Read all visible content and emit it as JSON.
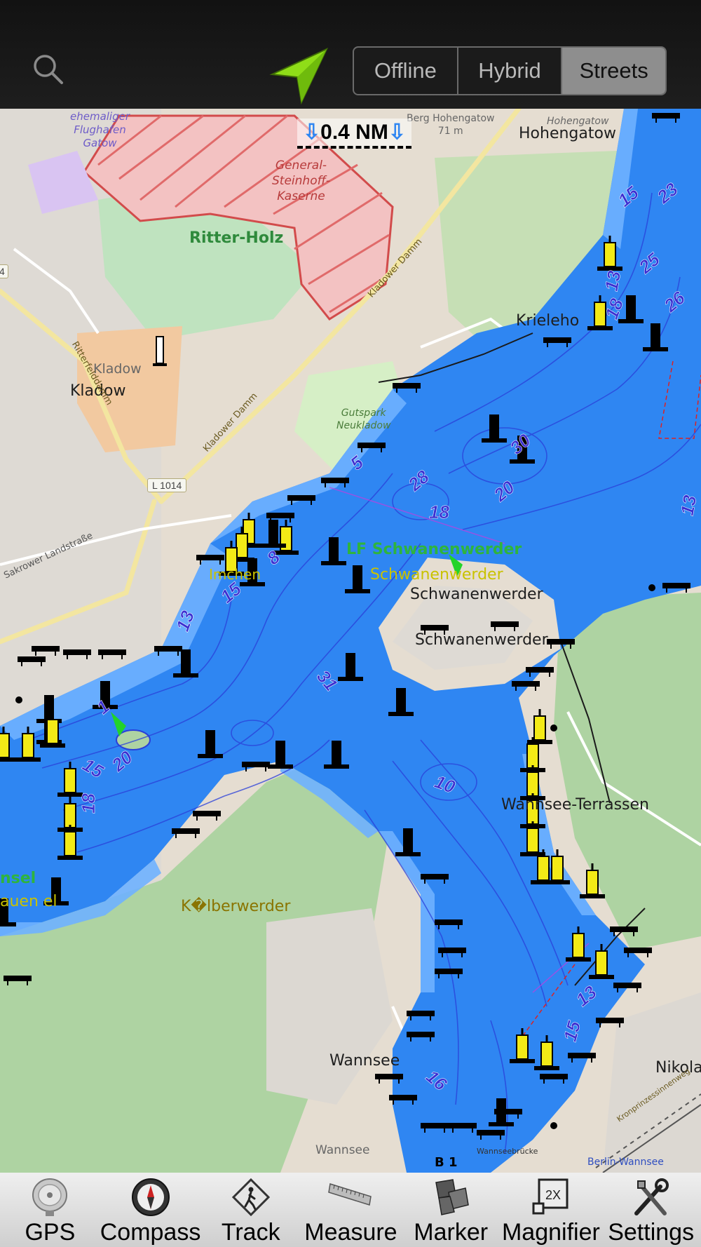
{
  "map_modes": {
    "offline": "Offline",
    "hybrid": "Hybrid",
    "streets": "Streets",
    "active": "Streets"
  },
  "scale_bar": "0.4 NM",
  "labels": {
    "airport": "ehemaliger\nFlughafen\nGatow",
    "kaserne": "General-\nSteinhoff-\nKaserne",
    "ritter_holz": "Ritter-Holz",
    "berg": "Berg Hohengatow\n71 m",
    "hohengatow_small": "Hohengatow",
    "hohengatow": "Hohengatow",
    "kladow_small": "Kladow",
    "kladow": "Kladow",
    "kladower_damm_1": "Kladower Damm",
    "kladower_damm_2": "Kladower Damm",
    "ritterfeld": "Ritterfelddamm",
    "gutspark": "Gutspark\nNeukladow",
    "l1014": "L 1014",
    "sakrower": "Sakrower Landstraße",
    "krieleho": "Krieleho",
    "lf_schwanenwerder": "LF Schwanenwerder",
    "schwanenwerder_yellow": "Schwanenwerder",
    "schwanenwerder_1": "Schwanenwerder",
    "schwanenwerder_2": "Schwanenwerder",
    "imchen": "Imchen",
    "wannsee_terrassen": "Wannsee-Terrassen",
    "pfaueninsel_1": "nsel",
    "pfaueninsel_2": "auen  el",
    "kaelberwerder": "K�lberwerder",
    "wannsee_1": "Wannsee",
    "wannsee_2": "Wannsee",
    "nikola": "Nikola",
    "b1": "B 1",
    "berlin_wannsee": "Berlin-Wannsee",
    "kronprinzessinnenweg": "Kronprinzessinnenweg",
    "wannseebruecke": "Wannseebrücke",
    "l4": "4"
  },
  "depths": [
    "15",
    "23",
    "13",
    "25",
    "18",
    "26",
    "5",
    "28",
    "30",
    "20",
    "18",
    "13",
    "15",
    "8",
    "13",
    "31",
    "1",
    "15",
    "20",
    "18",
    "10",
    "13",
    "15",
    "16"
  ],
  "toolbar": {
    "gps": "GPS",
    "compass": "Compass",
    "track": "Track",
    "measure": "Measure",
    "marker": "Marker",
    "magnifier": "Magnifier",
    "magnifier_badge": "2X",
    "settings": "Settings"
  },
  "icons": {
    "search": "search-icon",
    "nav": "location-arrow-icon",
    "gps": "gps-icon",
    "compass": "compass-icon",
    "track": "track-icon",
    "measure": "ruler-icon",
    "marker": "marker-icon",
    "magnifier": "magnifier-icon",
    "settings": "tools-icon"
  },
  "colors": {
    "water_deep": "#2f86f2",
    "water_shallow": "#6fb1ff",
    "contour": "#2a3fd9",
    "land": "#e5ddd1",
    "forest": "#aed3a2",
    "nav_arrow": "#8fdd18"
  }
}
